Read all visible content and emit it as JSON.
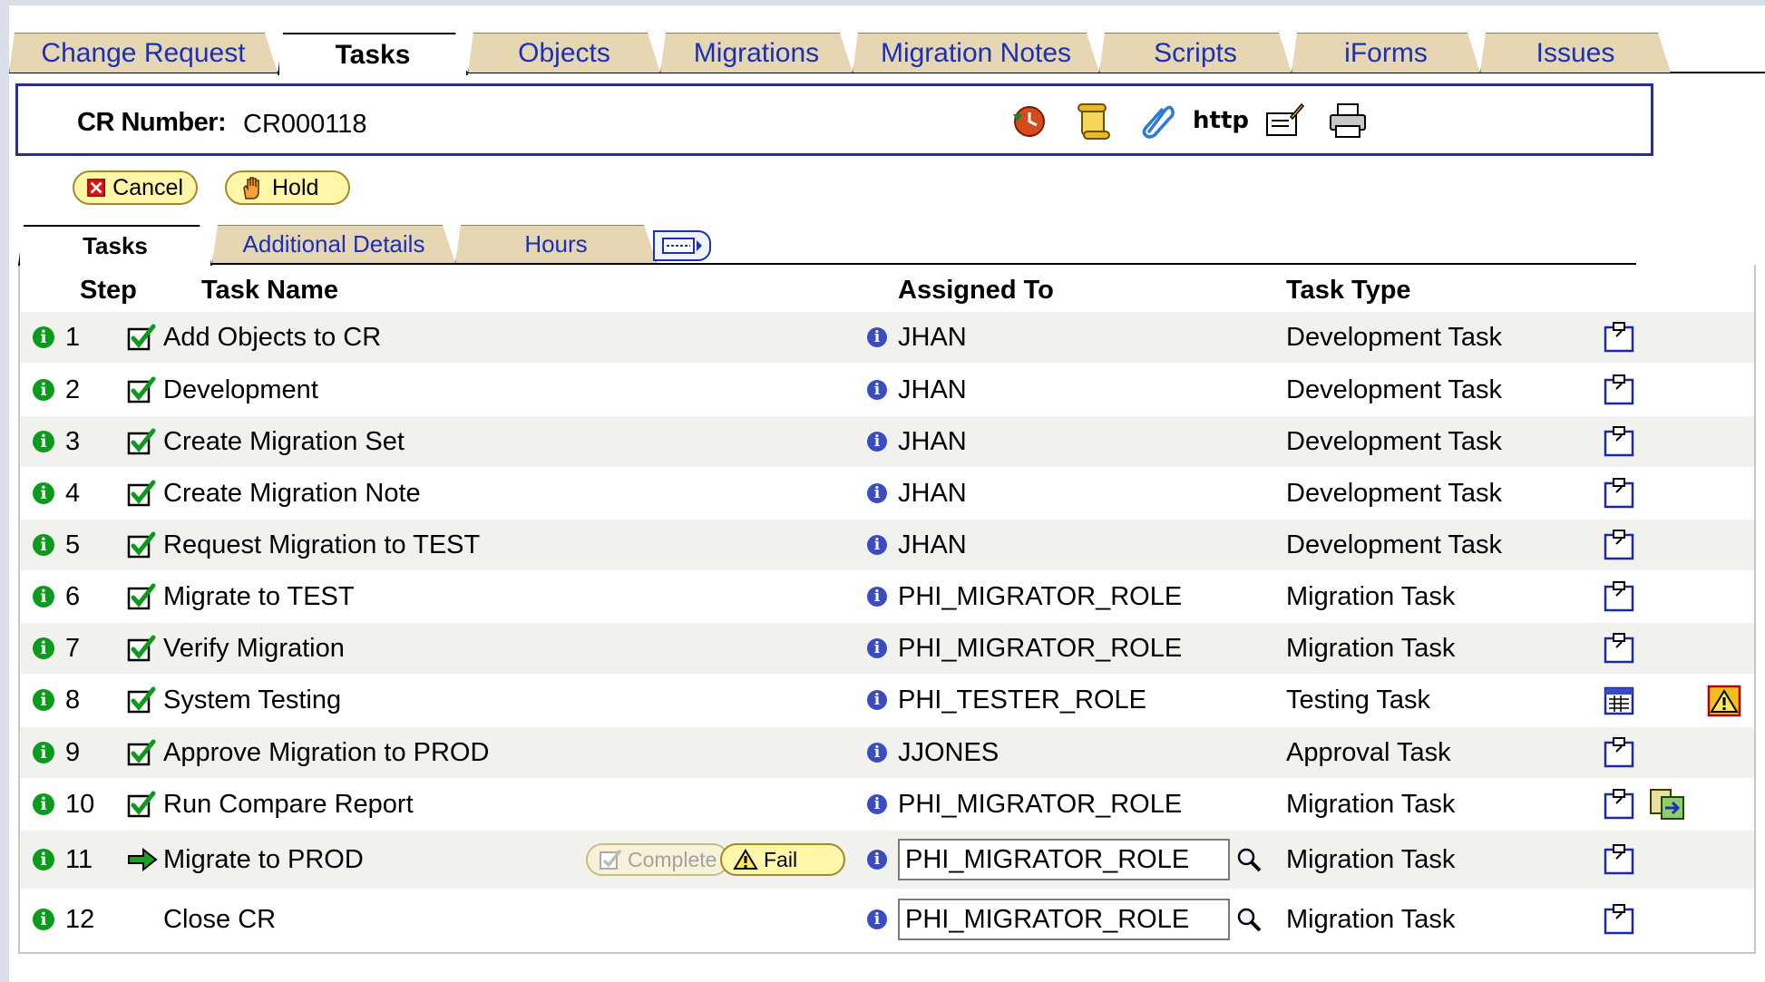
{
  "main_tabs": [
    {
      "label": "Change Request",
      "active": false
    },
    {
      "label": "Tasks",
      "active": true
    },
    {
      "label": "Objects",
      "active": false
    },
    {
      "label": "Migrations",
      "active": false
    },
    {
      "label": "Migration Notes",
      "active": false
    },
    {
      "label": "Scripts",
      "active": false
    },
    {
      "label": "iForms",
      "active": false
    },
    {
      "label": "Issues",
      "active": false
    }
  ],
  "cr": {
    "label": "CR Number:",
    "value": "CR000118",
    "toolbar_icons": [
      "history-icon",
      "scroll-icon",
      "paperclip-icon",
      "http-link-icon",
      "edit-folder-icon",
      "printer-icon"
    ],
    "http_label": "http"
  },
  "actions": {
    "cancel": "Cancel",
    "hold": "Hold"
  },
  "sub_tabs": [
    {
      "label": "Tasks",
      "active": true
    },
    {
      "label": "Additional Details",
      "active": false
    },
    {
      "label": "Hours",
      "active": false
    }
  ],
  "grid": {
    "headers": {
      "step": "Step",
      "task_name": "Task Name",
      "assigned_to": "Assigned To",
      "task_type": "Task Type"
    },
    "rows": [
      {
        "step": "1",
        "task": "Add Objects to CR",
        "status": "done",
        "assigned": "JHAN",
        "type": "Development Task"
      },
      {
        "step": "2",
        "task": "Development",
        "status": "done",
        "assigned": "JHAN",
        "type": "Development Task"
      },
      {
        "step": "3",
        "task": "Create Migration Set",
        "status": "done",
        "assigned": "JHAN",
        "type": "Development Task"
      },
      {
        "step": "4",
        "task": "Create Migration Note",
        "status": "done",
        "assigned": "JHAN",
        "type": "Development Task"
      },
      {
        "step": "5",
        "task": "Request Migration to TEST",
        "status": "done",
        "assigned": "JHAN",
        "type": "Development Task"
      },
      {
        "step": "6",
        "task": "Migrate to TEST",
        "status": "done",
        "assigned": "PHI_MIGRATOR_ROLE",
        "type": "Migration Task"
      },
      {
        "step": "7",
        "task": "Verify Migration",
        "status": "done",
        "assigned": "PHI_MIGRATOR_ROLE",
        "type": "Migration Task"
      },
      {
        "step": "8",
        "task": "System Testing",
        "status": "done",
        "assigned": "PHI_TESTER_ROLE",
        "type": "Testing Task"
      },
      {
        "step": "9",
        "task": "Approve Migration to PROD",
        "status": "done",
        "assigned": "JJONES",
        "type": "Approval Task"
      },
      {
        "step": "10",
        "task": "Run Compare Report",
        "status": "done",
        "assigned": "PHI_MIGRATOR_ROLE",
        "type": "Migration Task"
      },
      {
        "step": "11",
        "task": "Migrate to PROD",
        "status": "current",
        "assigned": "PHI_MIGRATOR_ROLE",
        "type": "Migration Task"
      },
      {
        "step": "12",
        "task": "Close CR",
        "status": "pending",
        "assigned": "PHI_MIGRATOR_ROLE",
        "type": "Migration Task"
      }
    ],
    "row_buttons": {
      "complete": "Complete",
      "fail": "Fail"
    }
  },
  "colors": {
    "tab_bg": "#e6d6b2",
    "link_blue": "#1a30b8",
    "box_border": "#2d2d9a",
    "check_green": "#0b9a1c",
    "alt_row": "#f1f1ee",
    "button_yellow": "#fff6a8"
  }
}
